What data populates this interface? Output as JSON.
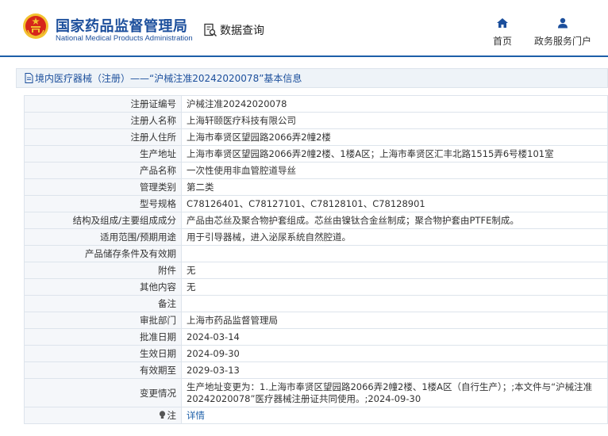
{
  "header": {
    "logo_icon": "national-emblem-icon",
    "brand_cn": "国家药品监督管理局",
    "brand_en": "National Medical Products Administration",
    "query_icon": "document-search-icon",
    "query_label": "数据查询",
    "nav": {
      "home_icon": "home-icon",
      "home_label": "首页",
      "portal_icon": "user-icon",
      "portal_label": "政务服务门户"
    }
  },
  "breadcrumb": {
    "icon": "document-icon",
    "text": "境内医疗器械（注册）——“沪械注准20242020078”基本信息"
  },
  "details": [
    {
      "label": "注册证编号",
      "value": "沪械注准20242020078"
    },
    {
      "label": "注册人名称",
      "value": "上海轩颐医疗科技有限公司"
    },
    {
      "label": "注册人住所",
      "value": "上海市奉贤区望园路2066弄2幢2楼"
    },
    {
      "label": "生产地址",
      "value": "上海市奉贤区望园路2066弄2幢2楼、1楼A区；上海市奉贤区汇丰北路1515弄6号楼101室"
    },
    {
      "label": "产品名称",
      "value": "一次性使用非血管腔道导丝"
    },
    {
      "label": "管理类别",
      "value": "第二类"
    },
    {
      "label": "型号规格",
      "value": "C78126401、C78127101、C78128101、C78128901"
    },
    {
      "label": "结构及组成/主要组成成分",
      "value": "产品由芯丝及聚合物护套组成。芯丝由镍钛合金丝制成；聚合物护套由PTFE制成。"
    },
    {
      "label": "适用范围/预期用途",
      "value": "用于引导器械，进入泌尿系统自然腔道。"
    },
    {
      "label": "产品储存条件及有效期",
      "value": ""
    },
    {
      "label": "附件",
      "value": "无"
    },
    {
      "label": "其他内容",
      "value": "无"
    },
    {
      "label": "备注",
      "value": ""
    },
    {
      "label": "审批部门",
      "value": "上海市药品监督管理局"
    },
    {
      "label": "批准日期",
      "value": "2024-03-14"
    },
    {
      "label": "生效日期",
      "value": "2024-09-30"
    },
    {
      "label": "有效期至",
      "value": "2029-03-13"
    },
    {
      "label": "变更情况",
      "value": "生产地址变更为：1.上海市奉贤区望园路2066弄2幢2楼、1楼A区（自行生产）；;本文件与“沪械注准20242020078”医疗器械注册证共同使用。;2024-09-30"
    }
  ],
  "note": {
    "icon": "lightbulb-icon",
    "label": "注",
    "link_label": "详情"
  },
  "colors": {
    "brand_blue": "#1c4f9c",
    "link_blue": "#1d5fa8",
    "label_bg": "#f5f7fa",
    "border": "#dde4ec",
    "emblem_red": "#d6261a",
    "emblem_gold": "#f2c230"
  }
}
